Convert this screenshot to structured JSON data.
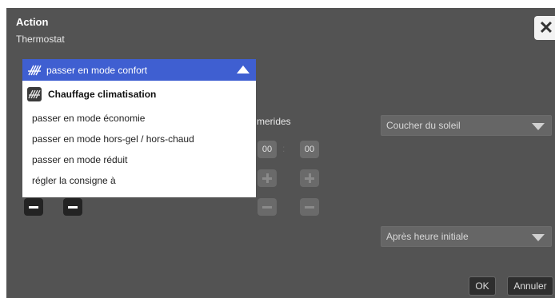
{
  "dialog": {
    "title": "Action",
    "subtitle": "Thermostat",
    "close_icon": "close-icon",
    "close_glyph": "✕"
  },
  "selector": {
    "value": "passer en mode confort",
    "icon": "heating-icon"
  },
  "menu": {
    "header": "Chauffage climatisation",
    "items": [
      "passer en mode économie",
      "passer en mode hors-gel / hors-chaud",
      "passer en mode réduit",
      "régler la consigne à"
    ]
  },
  "ephemerides": {
    "label": "merides",
    "hours": "00",
    "minutes": "00",
    "colon": ":"
  },
  "sunset_select": {
    "value": "Coucher du soleil"
  },
  "after_select": {
    "value": "Après heure initiale"
  },
  "buttons": {
    "ok": "OK",
    "cancel": "Annuler"
  },
  "colors": {
    "background": "#535353",
    "accent": "#3f5fd1",
    "menu_bg": "#ffffff"
  }
}
